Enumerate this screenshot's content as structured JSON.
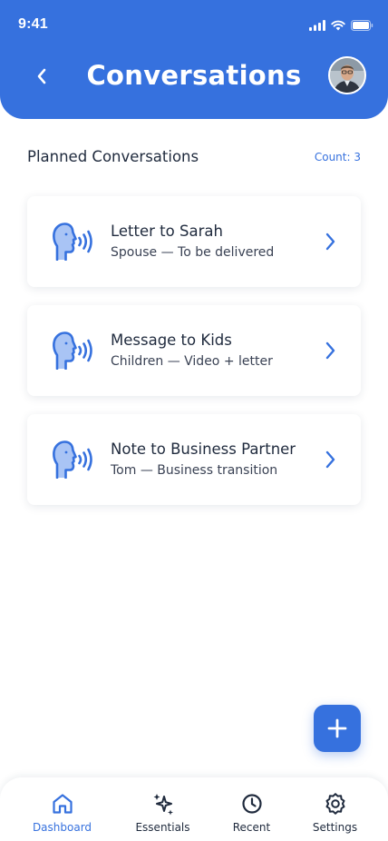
{
  "status_bar": {
    "time": "9:41"
  },
  "header": {
    "title": "Conversations"
  },
  "section": {
    "title": "Planned Conversations",
    "count": "Count: 3"
  },
  "conversations": [
    {
      "title": "Letter to Sarah",
      "subtitle": "Spouse — To be delivered",
      "icon": "speaking-head-icon"
    },
    {
      "title": "Message to Kids",
      "subtitle": "Children — Video + letter",
      "icon": "speaking-head-icon"
    },
    {
      "title": "Note to Business Partner",
      "subtitle": "Tom — Business transition",
      "icon": "speaking-head-icon"
    }
  ],
  "fab": {
    "icon": "plus-icon"
  },
  "nav": [
    {
      "label": "Dashboard",
      "icon": "home-icon",
      "active": true
    },
    {
      "label": "Essentials",
      "icon": "sparkle-icon",
      "active": false
    },
    {
      "label": "Recent",
      "icon": "clock-icon",
      "active": false
    },
    {
      "label": "Settings",
      "icon": "gear-icon",
      "active": false
    }
  ],
  "colors": {
    "accent": "#3671de",
    "text": "#1f2a3d",
    "icon_fill": "#a9c4f5"
  }
}
